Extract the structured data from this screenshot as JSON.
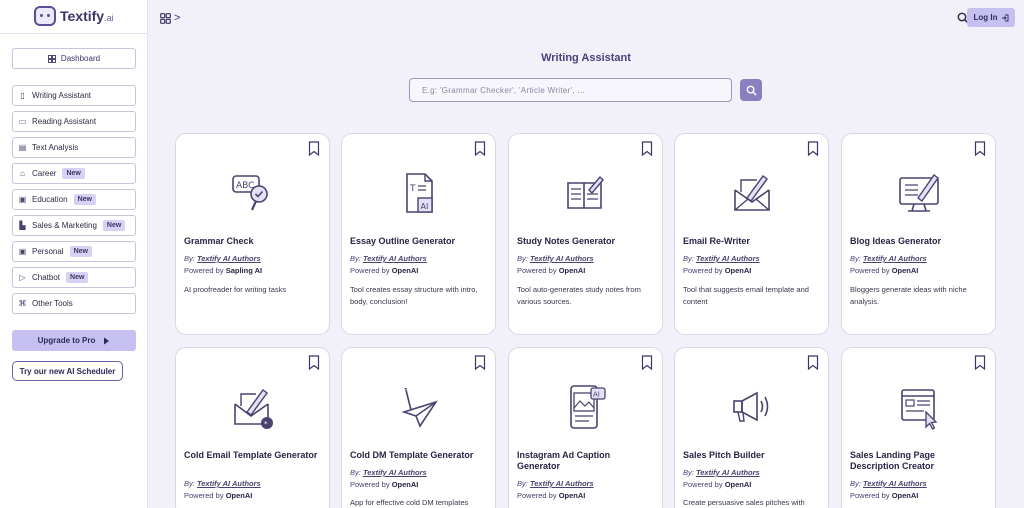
{
  "brand": {
    "name": "Textify",
    "suffix": ".ai"
  },
  "sidebar": {
    "dashboard_label": "Dashboard",
    "items": [
      {
        "label": "Writing Assistant",
        "icon": "document-icon",
        "badge": ""
      },
      {
        "label": "Reading Assistant",
        "icon": "book-icon",
        "badge": ""
      },
      {
        "label": "Text Analysis",
        "icon": "text-icon",
        "badge": ""
      },
      {
        "label": "Career",
        "icon": "briefcase-icon",
        "badge": "New"
      },
      {
        "label": "Education",
        "icon": "education-icon",
        "badge": "New"
      },
      {
        "label": "Sales & Marketing",
        "icon": "sales-icon",
        "badge": "New"
      },
      {
        "label": "Personal",
        "icon": "person-icon",
        "badge": "New"
      },
      {
        "label": "Chatbot",
        "icon": "chat-icon",
        "badge": "New"
      },
      {
        "label": "Other Tools",
        "icon": "tools-icon",
        "badge": ""
      }
    ],
    "upgrade_label": "Upgrade to Pro",
    "scheduler_label": "Try our new AI Scheduler"
  },
  "topbar": {
    "breadcrumb_sep": ">",
    "login_label": "Log In"
  },
  "main": {
    "title": "Writing Assistant",
    "search_placeholder": "E.g: 'Grammar Checker', 'Article Writer', ...",
    "cards": [
      {
        "title": "Grammar Check",
        "by_prefix": "By:",
        "author": "Textify AI Authors",
        "powered_prefix": "Powered by",
        "provider": "Sapling AI",
        "desc": "AI proofreader for writing tasks",
        "icon": "grammar-check-icon"
      },
      {
        "title": "Essay Outline Generator",
        "by_prefix": "By:",
        "author": "Textify AI Authors",
        "powered_prefix": "Powered by",
        "provider": "OpenAI",
        "desc": "Tool creates essay structure with intro, body, conclusion!",
        "icon": "essay-outline-icon"
      },
      {
        "title": "Study Notes Generator",
        "by_prefix": "By:",
        "author": "Textify AI Authors",
        "powered_prefix": "Powered by",
        "provider": "OpenAI",
        "desc": "Tool auto-generates study notes from various sources.",
        "icon": "study-notes-icon"
      },
      {
        "title": "Email Re-Writer",
        "by_prefix": "By:",
        "author": "Textify AI Authors",
        "powered_prefix": "Powered by",
        "provider": "OpenAI",
        "desc": "Tool that suggests email template and content",
        "icon": "email-rewrite-icon"
      },
      {
        "title": "Blog Ideas Generator",
        "by_prefix": "By:",
        "author": "Textify AI Authors",
        "powered_prefix": "Powered by",
        "provider": "OpenAI",
        "desc": "Bloggers generate ideas with niche analysis.",
        "icon": "blog-ideas-icon"
      },
      {
        "title": "Cold Email Template Generator",
        "by_prefix": "By:",
        "author": "Textify AI Authors",
        "powered_prefix": "Powered by",
        "provider": "OpenAI",
        "desc": "",
        "icon": "cold-email-icon"
      },
      {
        "title": "Cold DM Template Generator",
        "by_prefix": "By:",
        "author": "Textify AI Authors",
        "powered_prefix": "Powered by",
        "provider": "OpenAI",
        "desc": "App for effective cold DM templates",
        "icon": "paper-plane-icon"
      },
      {
        "title": "Instagram Ad Caption Generator",
        "by_prefix": "By:",
        "author": "Textify AI Authors",
        "powered_prefix": "Powered by",
        "provider": "OpenAI",
        "desc": "",
        "icon": "instagram-caption-icon"
      },
      {
        "title": "Sales Pitch Builder",
        "by_prefix": "By:",
        "author": "Textify AI Authors",
        "powered_prefix": "Powered by",
        "provider": "OpenAI",
        "desc": "Create persuasive sales pitches with",
        "icon": "megaphone-icon"
      },
      {
        "title": "Sales Landing Page Description Creator",
        "by_prefix": "By:",
        "author": "Textify AI Authors",
        "powered_prefix": "Powered by",
        "provider": "OpenAI",
        "desc": "",
        "icon": "landing-page-icon"
      }
    ]
  },
  "colors": {
    "accent": "#5b4e93",
    "button_bg": "#c5c0f0",
    "page_bg": "#f2f1fa"
  }
}
